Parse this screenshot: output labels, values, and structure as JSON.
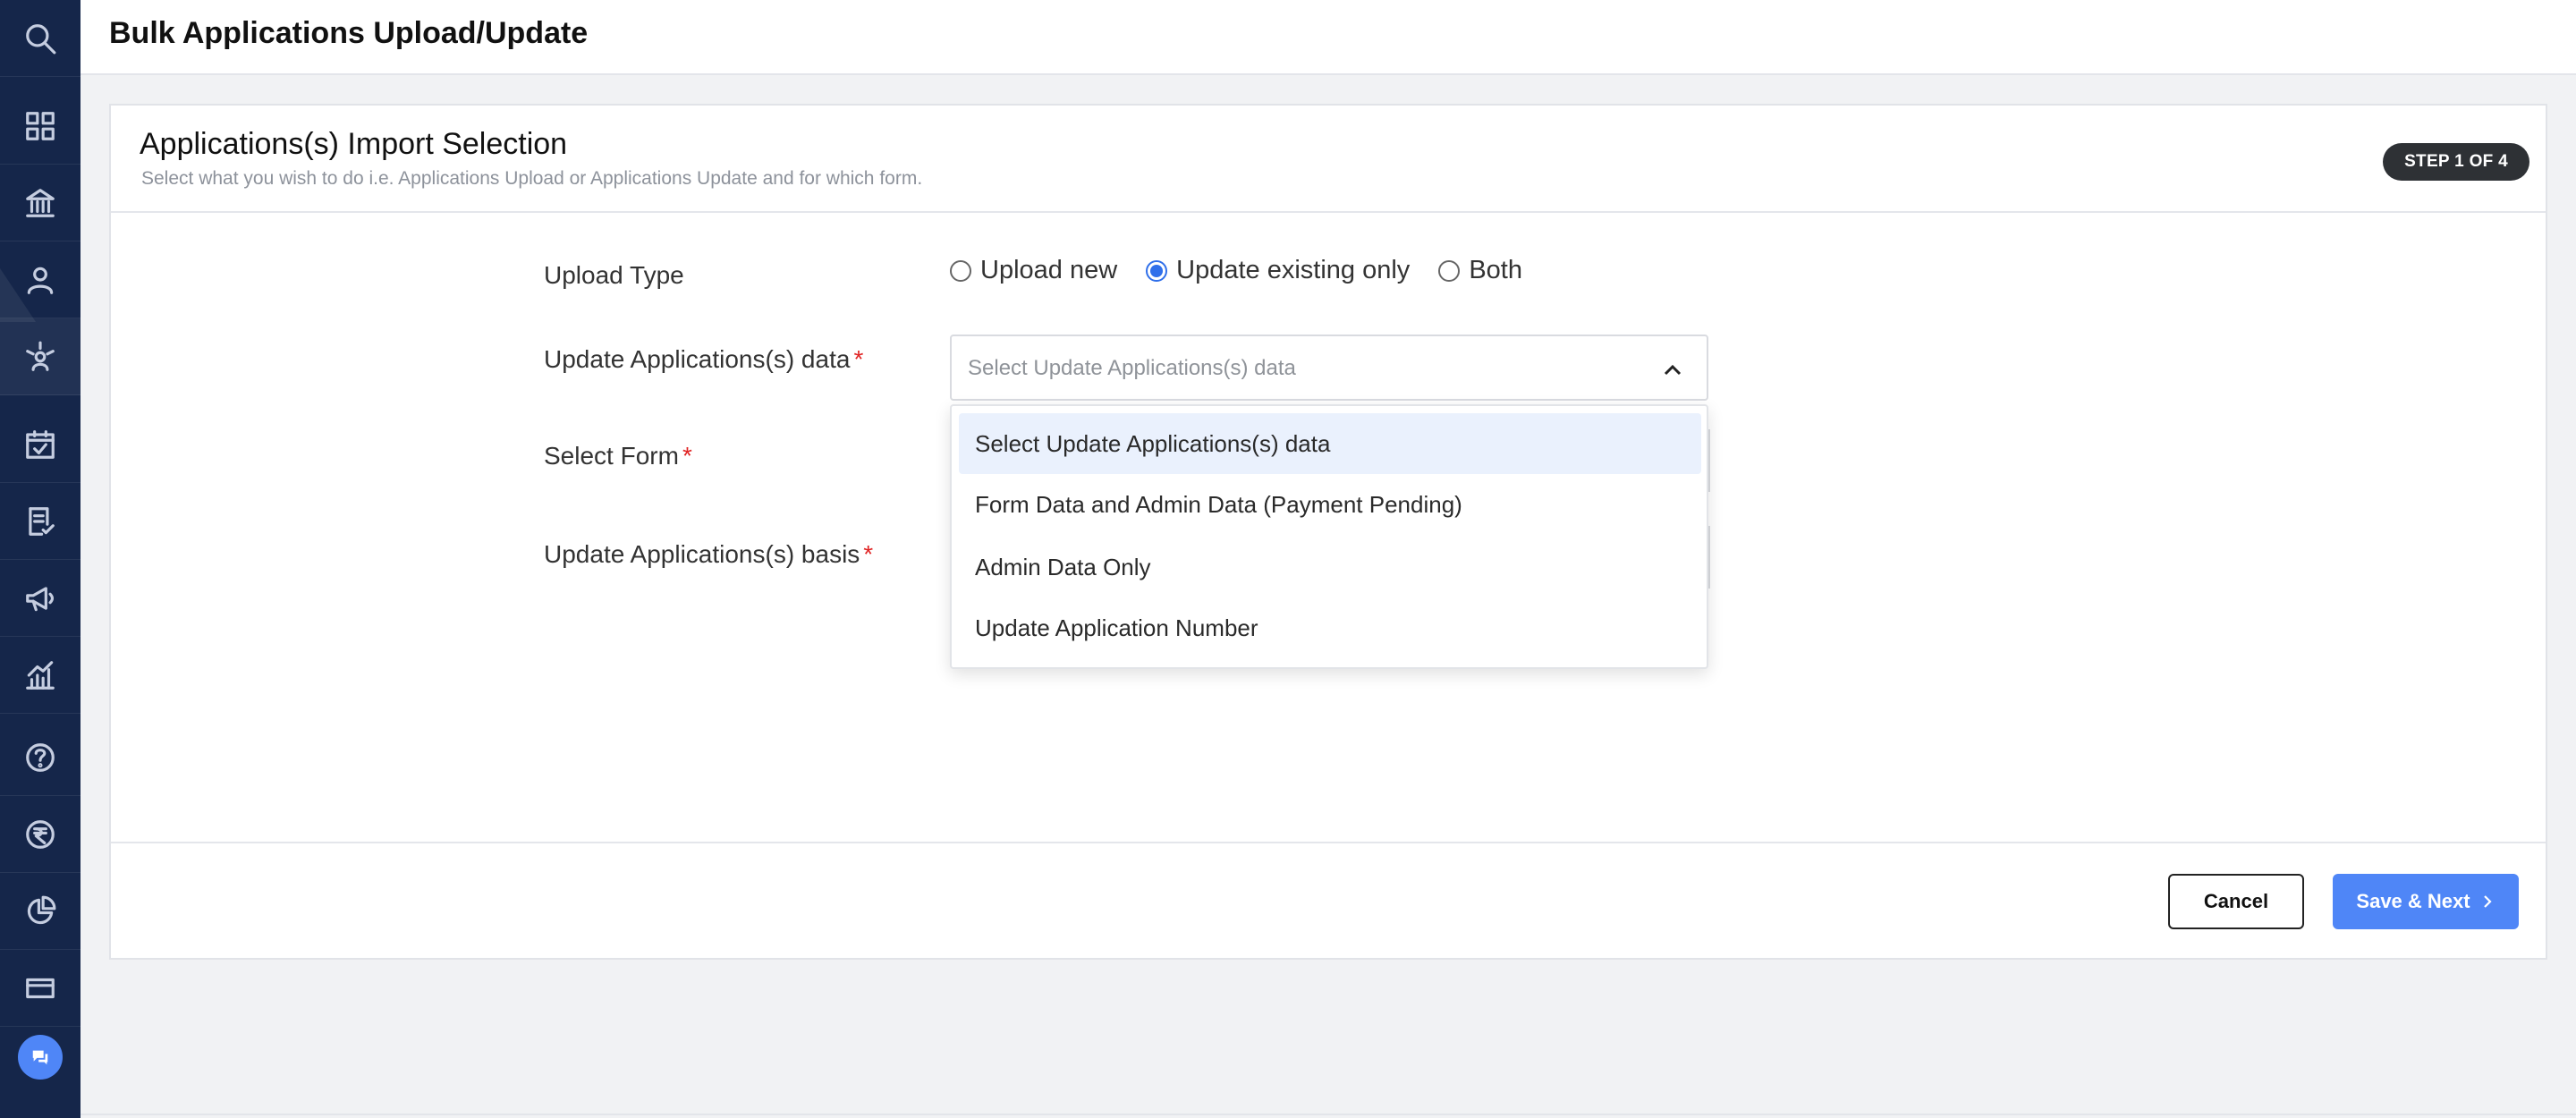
{
  "header": {
    "title": "Bulk Applications Upload/Update"
  },
  "card": {
    "title": "Applications(s) Import Selection",
    "subtitle": "Select what you wish to do i.e. Applications Upload or Applications Update and for which form.",
    "step": "STEP 1 OF 4"
  },
  "form": {
    "upload_type_label": "Upload Type",
    "radios": [
      {
        "label": "Upload new",
        "checked": false
      },
      {
        "label": "Update existing only",
        "checked": true
      },
      {
        "label": "Both",
        "checked": false
      }
    ],
    "update_data_label": "Update Applications(s) data",
    "update_data_placeholder": "Select Update Applications(s) data",
    "select_form_label": "Select Form",
    "update_basis_label": "Update Applications(s) basis",
    "required_mark": "*"
  },
  "dropdown": {
    "options": [
      "Select Update Applications(s) data",
      "Form Data and Admin Data (Payment Pending)",
      "Admin Data Only",
      "Update Application Number"
    ],
    "selected_index": 0
  },
  "footer": {
    "cancel_label": "Cancel",
    "next_label": "Save & Next"
  },
  "sidebar": {
    "icons": [
      "search-icon",
      "dashboard-icon",
      "institution-icon",
      "user-icon",
      "network-icon",
      "calendar-check-icon",
      "checklist-icon",
      "megaphone-icon",
      "analytics-icon",
      "help-icon",
      "rupee-icon",
      "pie-chart-icon",
      "card-icon"
    ]
  },
  "colors": {
    "sidebar": "#15264a",
    "accent": "#4f86f7",
    "radio": "#2f6fea",
    "required": "#e02424"
  }
}
